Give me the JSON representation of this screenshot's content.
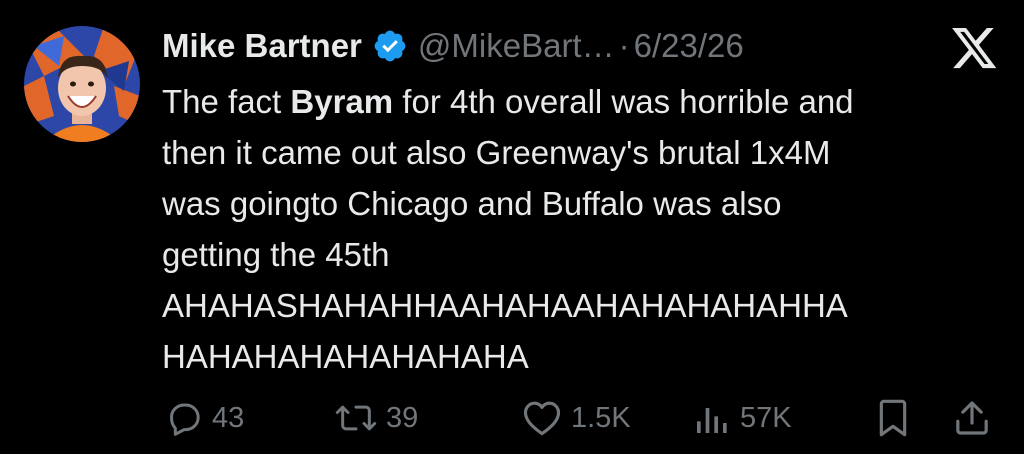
{
  "tweet": {
    "author_name": "Mike Bartner",
    "handle": "@MikeBart…",
    "separator": "·",
    "date": "6/23/26",
    "verified": true,
    "text_lines": [
      {
        "before": "The fact ",
        "bold": "Byram",
        "after": " for 4th overall was horrible and"
      },
      {
        "text": "then it came out also Greenway's brutal 1x4M"
      },
      {
        "text": "was goingto Chicago and Buffalo was also"
      },
      {
        "text": "getting the 45th"
      },
      {
        "text": "AHAHASHAHAHHAAHAHAAHAHAHAHAHHA"
      },
      {
        "text": "HAHAHAHAHAHAHAHA"
      }
    ]
  },
  "stats": {
    "replies": "43",
    "reposts": "39",
    "likes": "1.5K",
    "views": "57K"
  },
  "icons": {
    "platform": "x-logo-icon",
    "verified": "verified-badge-icon",
    "reply": "reply-icon",
    "repost": "repost-icon",
    "like": "heart-icon",
    "views": "views-chart-icon",
    "bookmark": "bookmark-icon",
    "share": "share-icon"
  },
  "colors": {
    "background": "#000000",
    "text_primary": "#e7e9ea",
    "text_secondary": "#71767b",
    "verified_blue": "#1d9bf0"
  }
}
